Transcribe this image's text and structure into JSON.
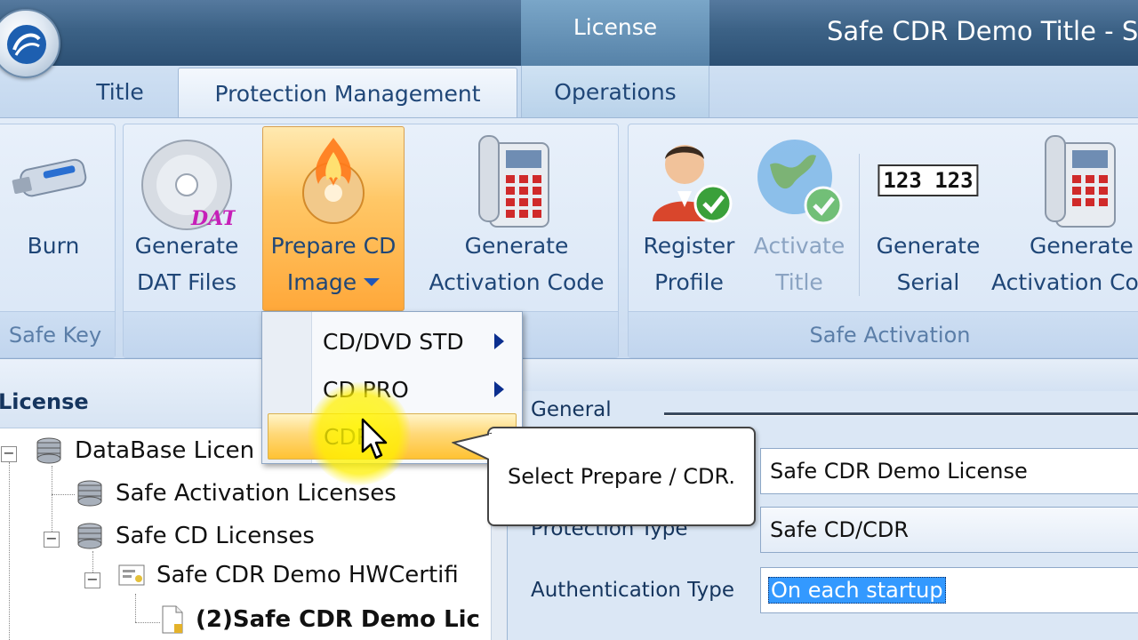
{
  "window": {
    "title": "Safe CDR Demo Title - Se",
    "context_tab": "License"
  },
  "tabs": [
    "Title",
    "Protection Management",
    "Operations"
  ],
  "ribbon": {
    "groups": [
      "Safe Key",
      "Safe Activation"
    ],
    "buttons": {
      "burn": "Burn",
      "gen_dat_1": "Generate",
      "gen_dat_2": "DAT Files",
      "prepare_1": "Prepare CD",
      "prepare_2": "Image",
      "gen_act_1": "Generate",
      "gen_act_2": "Activation Code",
      "register_1": "Register",
      "register_2": "Profile",
      "activate_1": "Activate",
      "activate_2": "Title",
      "serial_1": "Generate",
      "serial_2": "Serial",
      "gen_act2_1": "Generate",
      "gen_act2_2": "Activation Co"
    },
    "dat_badge": "DAT",
    "serial_icon_text": "123 123"
  },
  "dropdown": {
    "items": [
      "CD/DVD STD",
      "CD PRO",
      "CDR"
    ],
    "selected": "CDR"
  },
  "callout": "Select Prepare / CDR.",
  "left_pane": {
    "title": "License",
    "tree": [
      "DataBase Licen",
      "Safe Activation Licenses",
      "Safe CD Licenses",
      "Safe CDR Demo HWCertifi",
      "(2)Safe CDR Demo Lic"
    ]
  },
  "right_pane": {
    "section": "General",
    "fields": {
      "name_value": "Safe CDR Demo License",
      "protection_label": "Protection Type",
      "protection_value": "Safe CD/CDR",
      "auth_label": "Authentication Type",
      "auth_value": "On each startup"
    }
  }
}
